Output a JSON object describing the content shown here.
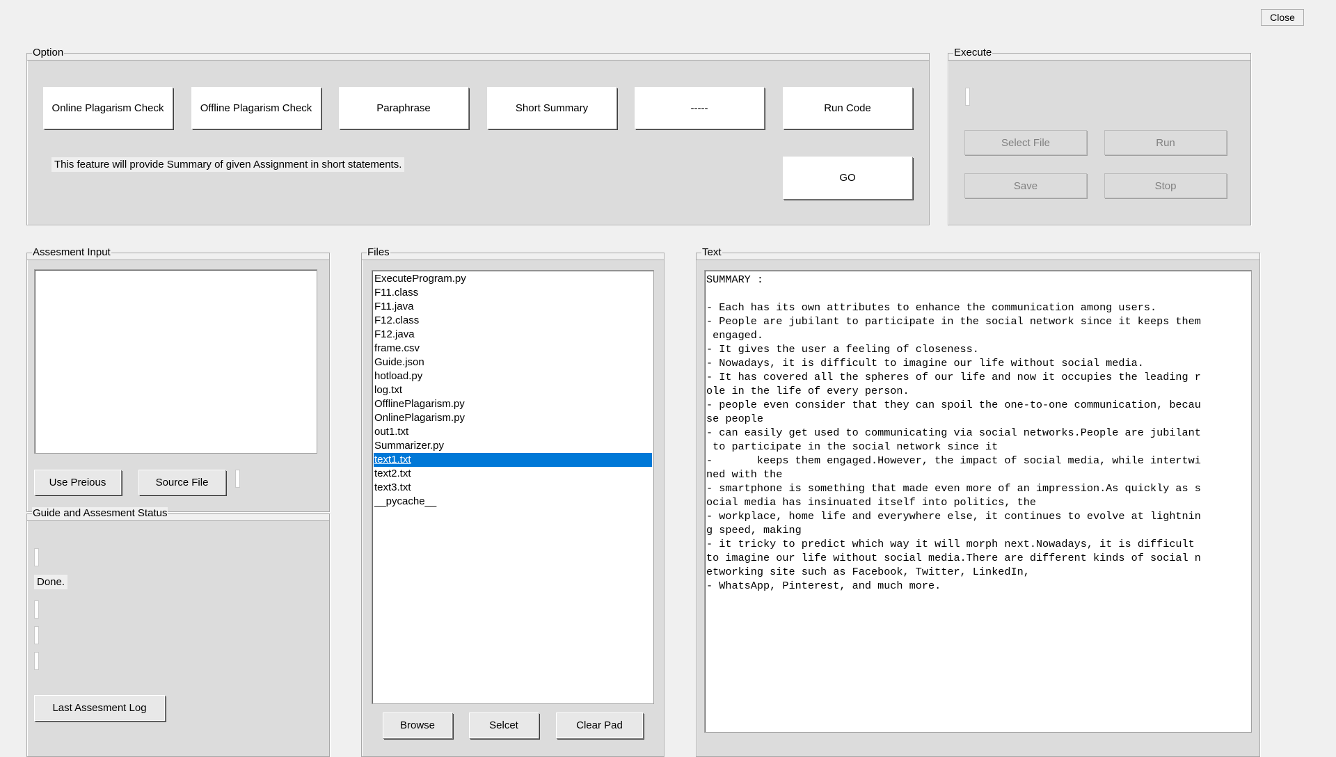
{
  "window": {
    "close_label": "Close"
  },
  "option": {
    "legend": "Option",
    "buttons": [
      "Online Plagarism Check",
      "Offline Plagarism Check",
      "Paraphrase",
      "Short Summary",
      "-----",
      "Run Code"
    ],
    "description": "This feature will provide Summary of given Assignment in short statements.",
    "go_label": "GO"
  },
  "execute": {
    "legend": "Execute",
    "select_file_label": "Select File",
    "run_label": "Run",
    "save_label": "Save",
    "stop_label": "Stop"
  },
  "assesment_input": {
    "legend": "Assesment Input",
    "value": "",
    "use_previous_label": "Use Preious",
    "source_file_label": "Source File"
  },
  "guide": {
    "legend": "Guide and Assesment Status",
    "status_text": "Done.",
    "last_log_label": "Last Assesment Log"
  },
  "files": {
    "legend": "Files",
    "items": [
      "ExecuteProgram.py",
      "F11.class",
      "F11.java",
      "F12.class",
      "F12.java",
      "frame.csv",
      "Guide.json",
      "hotload.py",
      "log.txt",
      "OfflinePlagarism.py",
      "OnlinePlagarism.py",
      "out1.txt",
      "Summarizer.py",
      "text1.txt",
      "text2.txt",
      "text3.txt",
      "__pycache__"
    ],
    "selected": "text1.txt",
    "browse_label": "Browse",
    "select_label": "Selcet",
    "clear_label": "Clear Pad"
  },
  "text": {
    "legend": "Text",
    "lines": [
      "SUMMARY :",
      "",
      "- Each has its own attributes to enhance the communication among users.",
      "- People are jubilant to participate in the social network since it keeps them",
      " engaged.",
      "- It gives the user a feeling of closeness.",
      "- Nowadays, it is difficult to imagine our life without social media.",
      "- It has covered all the spheres of our life and now it occupies the leading r",
      "ole in the life of every person.",
      "- people even consider that they can spoil the one-to-one communication, becau",
      "se people",
      "- can easily get used to communicating via social networks.People are jubilant",
      " to participate in the social network since it",
      "-       keeps them engaged.However, the impact of social media, while intertwi",
      "ned with the",
      "- smartphone is something that made even more of an impression.As quickly as s",
      "ocial media has insinuated itself into politics, the",
      "- workplace, home life and everywhere else, it continues to evolve at lightnin",
      "g speed, making",
      "- it tricky to predict which way it will morph next.Nowadays, it is difficult",
      "to imagine our life without social media.There are different kinds of social n",
      "etworking site such as Facebook, Twitter, LinkedIn,",
      "- WhatsApp, Pinterest, and much more."
    ]
  },
  "colors": {
    "selection": "#0078d7",
    "background": "#f0f0f0",
    "group": "#dcdcdc"
  }
}
